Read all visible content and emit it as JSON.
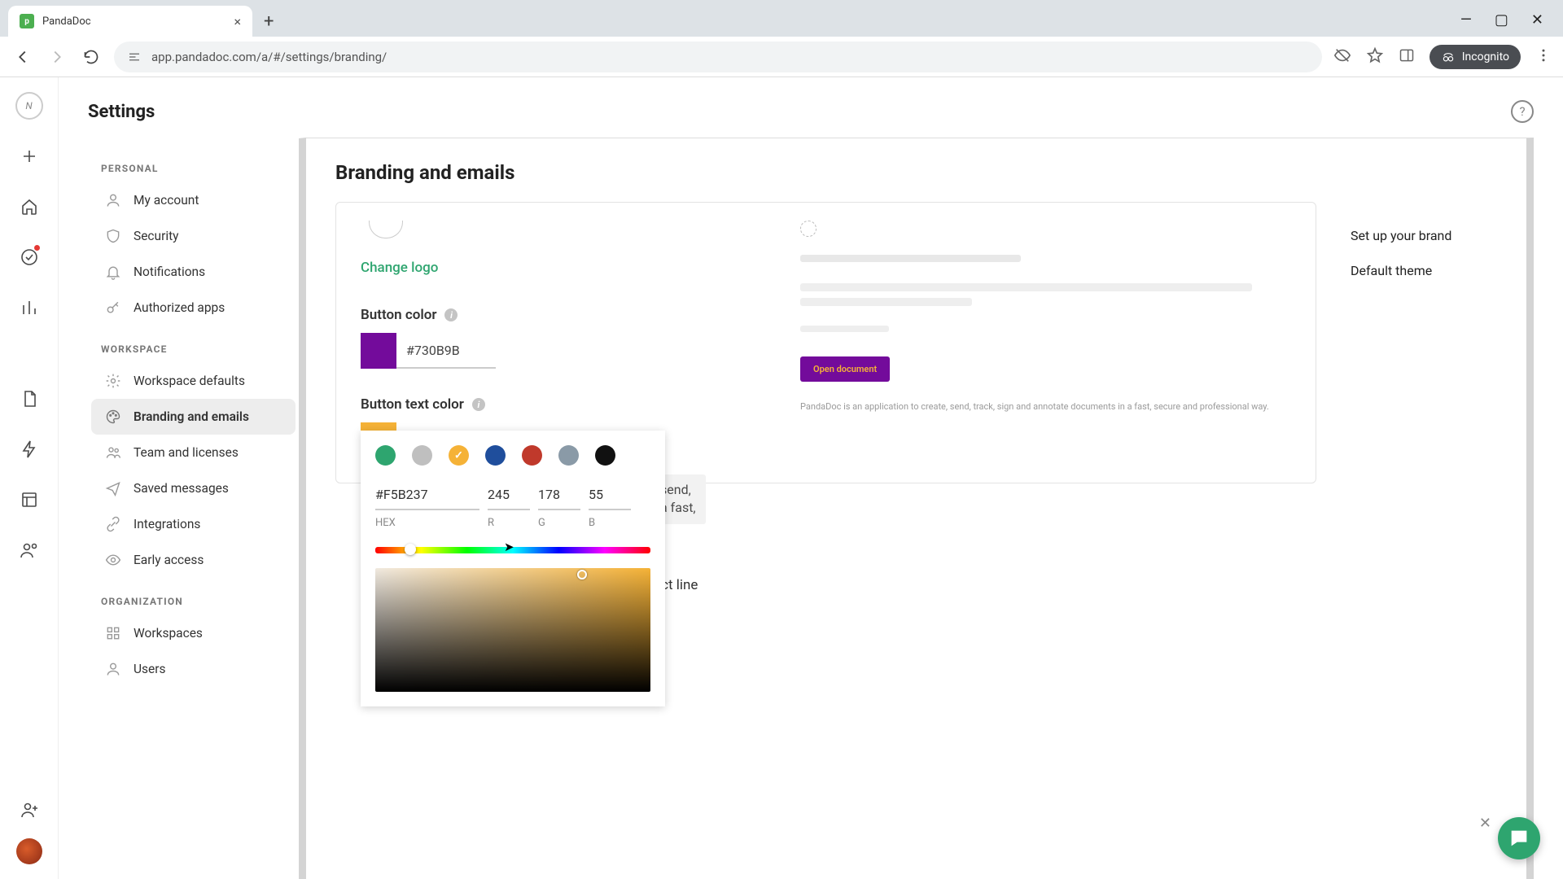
{
  "browser": {
    "tab_title": "PandaDoc",
    "url": "app.pandadoc.com/a/#/settings/branding/",
    "incognito": "Incognito"
  },
  "header": {
    "title": "Settings"
  },
  "sidebar": {
    "sections": {
      "personal": {
        "label": "PERSONAL"
      },
      "workspace": {
        "label": "WORKSPACE"
      },
      "organization": {
        "label": "ORGANIZATION"
      }
    },
    "items": {
      "account": "My account",
      "security": "Security",
      "notifications": "Notifications",
      "apps": "Authorized apps",
      "defaults": "Workspace defaults",
      "branding": "Branding and emails",
      "team": "Team and licenses",
      "saved": "Saved messages",
      "integrations": "Integrations",
      "early": "Early access",
      "workspaces": "Workspaces",
      "users": "Users"
    }
  },
  "main": {
    "title": "Branding and emails",
    "change_logo": "Change logo",
    "button_color_label": "Button color",
    "button_color_value": "#730B9B",
    "button_text_color_label": "Button text color",
    "button_text_color_value": "#F5B237",
    "behind_text1": "send,",
    "behind_text2": "a fast,",
    "behind_text3": "ject line"
  },
  "picker": {
    "hex": "#F5B237",
    "r": "245",
    "g": "178",
    "b": "55",
    "labels": {
      "hex": "HEX",
      "r": "R",
      "g": "G",
      "b": "B"
    },
    "presets": [
      {
        "color": "#2ea56f",
        "selected": false
      },
      {
        "color": "#bfbfbf",
        "selected": false
      },
      {
        "color": "#F5B237",
        "selected": true
      },
      {
        "color": "#1f4e9c",
        "selected": false
      },
      {
        "color": "#c0392b",
        "selected": false
      },
      {
        "color": "#8a9aa7",
        "selected": false
      },
      {
        "color": "#111111",
        "selected": false
      }
    ]
  },
  "preview": {
    "button": "Open document",
    "footer": "PandaDoc is an application to create, send, track, sign and annotate documents in a fast, secure and professional way."
  },
  "rightnav": {
    "brand": "Set up your brand",
    "theme": "Default theme"
  },
  "colors": {
    "button": "#730B9B",
    "button_text": "#F5B237",
    "accent": "#2ea56f"
  }
}
